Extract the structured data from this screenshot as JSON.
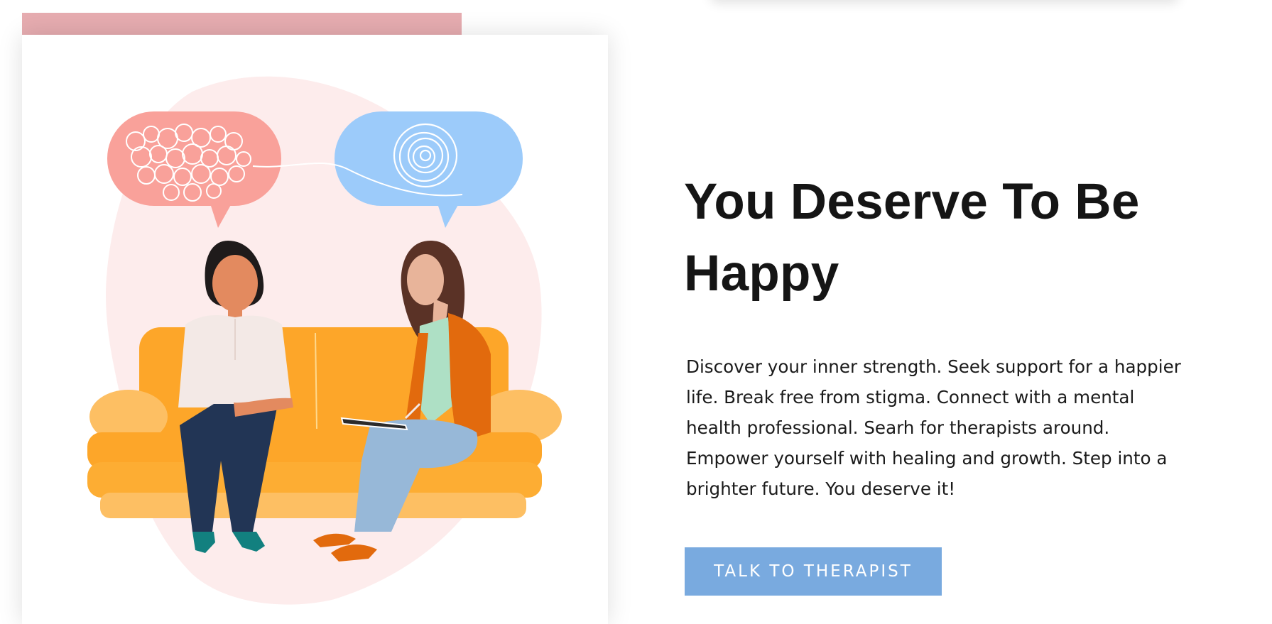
{
  "hero": {
    "headline": "You Deserve To Be Happy",
    "description": "Discover your inner strength. Seek support for a happier life. Break free from stigma. Connect with a mental health professional. Searh for therapists around. Empower yourself with healing and growth. Step into a brighter future. You deserve it!",
    "cta_label": "TALK TO THERAPIST"
  },
  "colors": {
    "accent_bar": "#e6acb0",
    "button": "#79aadf",
    "blob": "#fdecec",
    "sofa": "#fda629",
    "thought_tangled": "#f9a19a",
    "thought_calm": "#9ccbfa"
  },
  "icons": {
    "tangled_thought": "tangled-scribble-icon",
    "calm_thought": "spiral-icon"
  }
}
